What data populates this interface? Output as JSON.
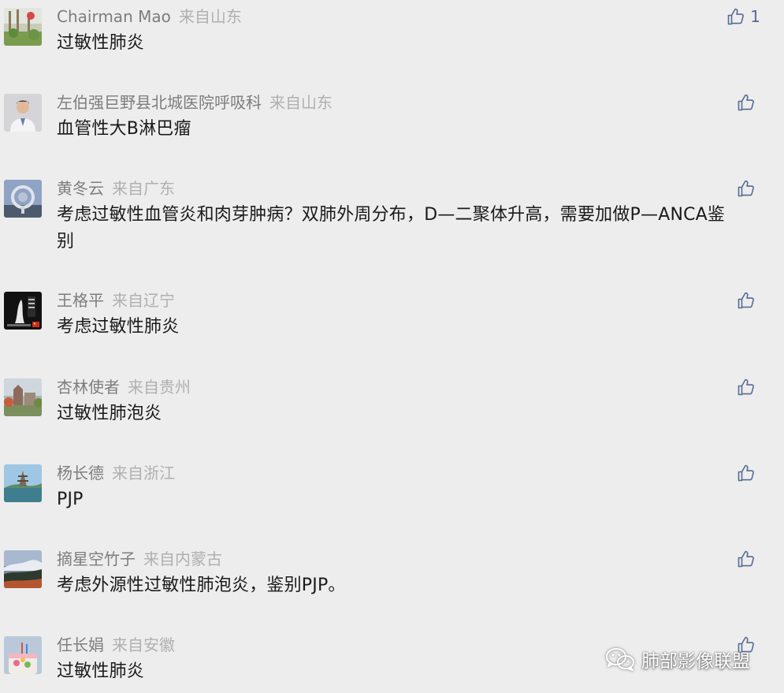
{
  "comments": [
    {
      "author": "Chairman Mao",
      "location": "来自山东",
      "text": "过敏性肺炎",
      "likes": "1"
    },
    {
      "author": "左伯强巨野县北城医院呼吸科",
      "location": "来自山东",
      "text": "血管性大B淋巴瘤",
      "likes": ""
    },
    {
      "author": "黄冬云",
      "location": "来自广东",
      "text": "考虑过敏性血管炎和肉芽肿病？双肺外周分布，D—二聚体升高，需要加做P—ANCA鉴别",
      "likes": ""
    },
    {
      "author": "王格平",
      "location": "来自辽宁",
      "text": "考虑过敏性肺炎",
      "likes": ""
    },
    {
      "author": "杏林使者",
      "location": "来自贵州",
      "text": "过敏性肺泡炎",
      "likes": ""
    },
    {
      "author": "杨长德",
      "location": "来自浙江",
      "text": "PJP",
      "likes": ""
    },
    {
      "author": "摘星空竹子",
      "location": "来自内蒙古",
      "text": "考虑外源性过敏性肺泡炎，鉴别PJP。",
      "likes": ""
    },
    {
      "author": "任长娟",
      "location": "来自安徽",
      "text": "过敏性肺炎",
      "likes": ""
    }
  ],
  "watermark": {
    "text": "肺部影像联盟",
    "icon": "wechat-icon"
  },
  "colors": {
    "background": "#ededed",
    "author": "#7d7d7d",
    "location": "#b0b0b0",
    "text": "#1a1a1a",
    "like": "#576b95"
  },
  "icons": {
    "like": "thumbs-up-icon"
  }
}
